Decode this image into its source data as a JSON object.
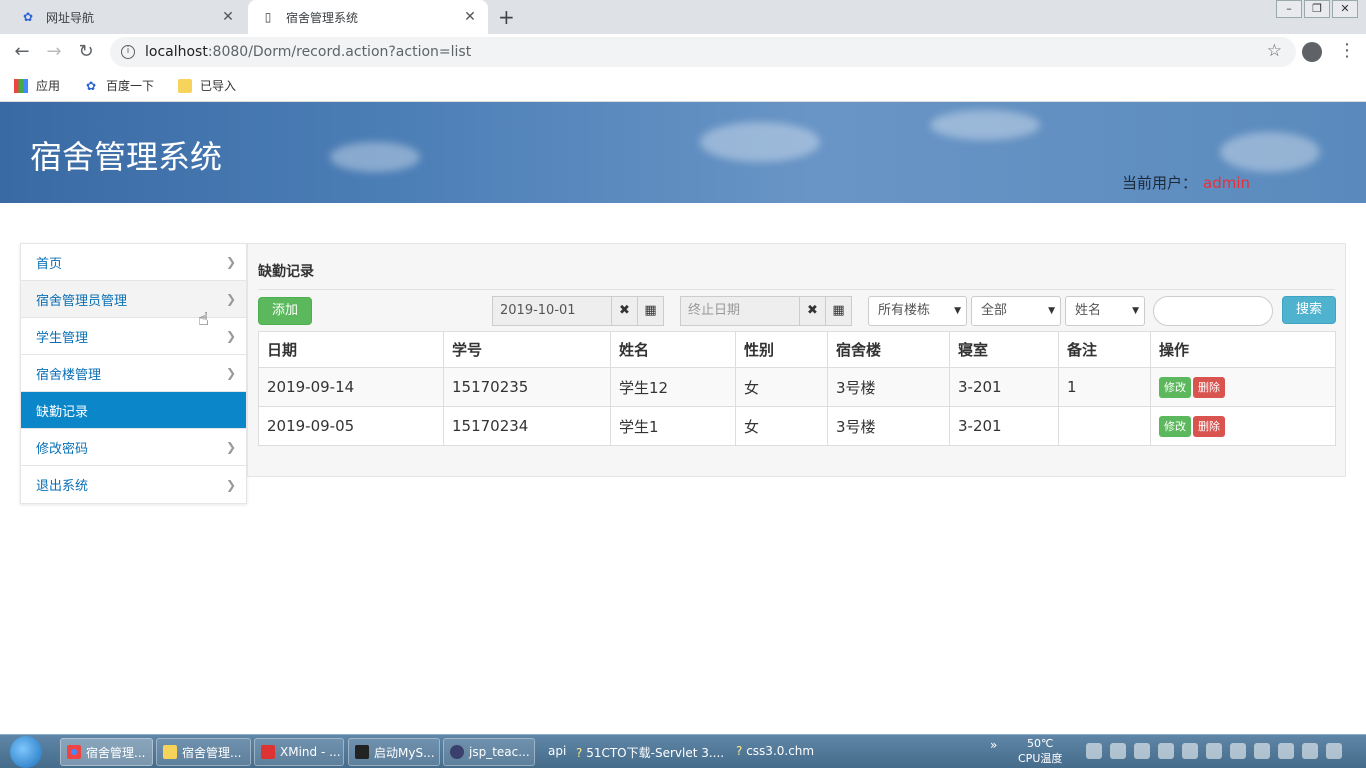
{
  "browser": {
    "tabs": [
      {
        "title": "网址导航",
        "icon": "baidu-paw-icon"
      },
      {
        "title": "宿舍管理系统",
        "icon": "page-icon"
      }
    ],
    "url_host": "localhost",
    "url_rest": ":8080/Dorm/record.action?action=list",
    "bookmarks": [
      {
        "label": "应用",
        "icon": "apps-icon"
      },
      {
        "label": "百度一下",
        "icon": "baidu-paw-icon"
      },
      {
        "label": "已导入",
        "icon": "folder-icon"
      }
    ]
  },
  "header": {
    "title": "宿舍管理系统",
    "user_label": "当前用户：",
    "user_name": "admin"
  },
  "sidebar": {
    "items": [
      {
        "label": "首页"
      },
      {
        "label": "宿舍管理员管理"
      },
      {
        "label": "学生管理"
      },
      {
        "label": "宿舍楼管理"
      },
      {
        "label": "缺勤记录"
      },
      {
        "label": "修改密码"
      },
      {
        "label": "退出系统"
      }
    ],
    "active_index": 4
  },
  "main": {
    "title": "缺勤记录",
    "add_label": "添加",
    "start_date": "2019-10-01",
    "end_date_placeholder": "终止日期",
    "building_select": "所有楼栋",
    "range_select": "全部",
    "field_select": "姓名",
    "search_value": "",
    "search_label": "搜索",
    "table": {
      "headers": [
        "日期",
        "学号",
        "姓名",
        "性别",
        "宿舍楼",
        "寝室",
        "备注",
        "操作"
      ],
      "rows": [
        {
          "date": "2019-09-14",
          "student_no": "15170235",
          "name": "学生12",
          "gender": "女",
          "building": "3号楼",
          "room": "3-201",
          "remark": "1"
        },
        {
          "date": "2019-09-05",
          "student_no": "15170234",
          "name": "学生1",
          "gender": "女",
          "building": "3号楼",
          "room": "3-201",
          "remark": ""
        }
      ],
      "edit_label": "修改",
      "delete_label": "删除"
    }
  },
  "taskbar": {
    "tasks": [
      {
        "label": "宿舍管理..."
      },
      {
        "label": "宿舍管理..."
      },
      {
        "label": "XMind - ..."
      },
      {
        "label": "启动MyS..."
      },
      {
        "label": "jsp_teac..."
      }
    ],
    "extra_items": [
      "api",
      "51CTO下载-Servlet 3....",
      "css3.0.chm"
    ],
    "overflow": "»",
    "temperature": "50℃",
    "temperature_label": "CPU温度"
  }
}
